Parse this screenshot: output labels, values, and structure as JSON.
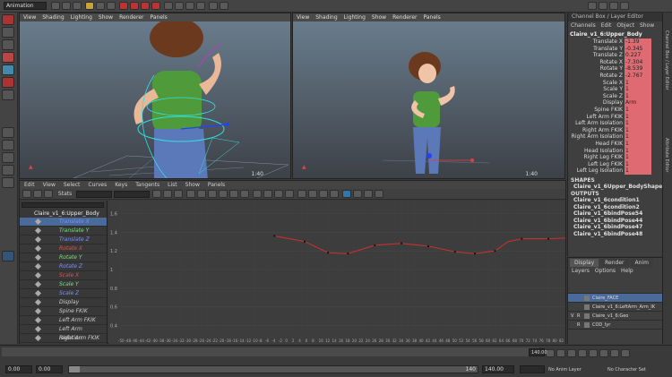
{
  "top_toolbar": {
    "mode": "Animation"
  },
  "viewport_left": {
    "menu": [
      "View",
      "Shading",
      "Lighting",
      "Show",
      "Renderer",
      "Panels"
    ],
    "fps": "1:40"
  },
  "viewport_right": {
    "menu": [
      "View",
      "Shading",
      "Lighting",
      "Show",
      "Renderer",
      "Panels"
    ],
    "fps": "1:40"
  },
  "channel_box": {
    "title": "Channel Box / Layer Editor",
    "menu": [
      "Channels",
      "Edit",
      "Object",
      "Show"
    ],
    "object": "Claire_v1_6:Upper_Body",
    "attributes": [
      {
        "label": "Translate X",
        "value": "-1.39"
      },
      {
        "label": "Translate Y",
        "value": "-0.345"
      },
      {
        "label": "Translate Z",
        "value": "0.227"
      },
      {
        "label": "Rotate X",
        "value": "-7.304"
      },
      {
        "label": "Rotate Y",
        "value": "-8.539"
      },
      {
        "label": "Rotate Z",
        "value": "-2.767"
      },
      {
        "label": "Scale X",
        "value": "1"
      },
      {
        "label": "Scale Y",
        "value": "1"
      },
      {
        "label": "Scale Z",
        "value": "1"
      },
      {
        "label": "Display",
        "value": "Arm"
      },
      {
        "label": "Spine FKIK",
        "value": "1"
      },
      {
        "label": "Left Arm FKIK",
        "value": "1"
      },
      {
        "label": "Left Arm Isolation",
        "value": "1"
      },
      {
        "label": "Right Arm FKIK",
        "value": "1"
      },
      {
        "label": "Right Arm Isolation",
        "value": "1"
      },
      {
        "label": "Head FKIK",
        "value": "1"
      },
      {
        "label": "Head Isolation",
        "value": "1"
      },
      {
        "label": "Right Leg FKIK",
        "value": "1"
      },
      {
        "label": "Left Leg FKIK",
        "value": "1"
      },
      {
        "label": "Left Leg Isolation",
        "value": "1"
      }
    ],
    "shapes_header": "SHAPES",
    "shapes": [
      "Claire_v1_6Upper_BodyShape"
    ],
    "outputs_header": "OUTPUTS",
    "outputs": [
      "Claire_v1_6condition1",
      "Claire_v1_6condition2",
      "Claire_v1_6bindPose54",
      "Claire_v1_6bindPose44",
      "Claire_v1_6bindPose47",
      "Claire_v1_6bindPose48"
    ]
  },
  "layer_editor": {
    "tabs": [
      "Display",
      "Render",
      "Anim"
    ],
    "menu": [
      "Layers",
      "Options",
      "Help"
    ],
    "layers": [
      {
        "v": "",
        "r": "",
        "name": "Claire_FACE"
      },
      {
        "v": "",
        "r": "",
        "name": "Claire_v1_6:LeftArm_Arm_IK"
      },
      {
        "v": "V",
        "r": "R",
        "name": "Claire_v1_6:Geo"
      },
      {
        "v": "",
        "r": "R",
        "name": "COD_Iyr"
      }
    ]
  },
  "graph_editor": {
    "menu": [
      "Edit",
      "View",
      "Select",
      "Curves",
      "Keys",
      "Tangents",
      "List",
      "Show",
      "Panels"
    ],
    "stats_label": "Stats",
    "outliner_root": "Claire_v1_6:Upper_Body",
    "channels": [
      {
        "name": "Translate X",
        "color": "#7f8fff"
      },
      {
        "name": "Translate Y",
        "color": "#7ce07c"
      },
      {
        "name": "Translate Z",
        "color": "#7f8fff"
      },
      {
        "name": "Rotate X",
        "color": "#e05050"
      },
      {
        "name": "Rotate Y",
        "color": "#7ce07c"
      },
      {
        "name": "Rotate Z",
        "color": "#7f8fff"
      },
      {
        "name": "Scale X",
        "color": "#e05050"
      },
      {
        "name": "Scale Y",
        "color": "#7ce07c"
      },
      {
        "name": "Scale Z",
        "color": "#7f8fff"
      },
      {
        "name": "Display",
        "color": "#cccccc"
      },
      {
        "name": "Spine FKIK",
        "color": "#cccccc"
      },
      {
        "name": "Left Arm FKIK",
        "color": "#cccccc"
      },
      {
        "name": "Left Arm Isolation",
        "color": "#cccccc"
      },
      {
        "name": "Right Arm FKIK",
        "color": "#cccccc"
      }
    ],
    "y_ticks": [
      "1.6",
      "1.4",
      "1.2",
      "1",
      "0.8",
      "0.6",
      "0.4"
    ],
    "x_start": -50,
    "x_step": 2,
    "x_count": 67,
    "curve": [
      [
        -4,
        1.36
      ],
      [
        5,
        1.3
      ],
      [
        12,
        1.18
      ],
      [
        18,
        1.17
      ],
      [
        26,
        1.26
      ],
      [
        34,
        1.28
      ],
      [
        42,
        1.25
      ],
      [
        50,
        1.19
      ],
      [
        56,
        1.17
      ],
      [
        62,
        1.2
      ],
      [
        66,
        1.3
      ],
      [
        70,
        1.33
      ],
      [
        78,
        1.33
      ],
      [
        84,
        1.34
      ],
      [
        92,
        1.34
      ]
    ],
    "keys": [
      [
        -4,
        1.36
      ],
      [
        5,
        1.3
      ],
      [
        12,
        1.18
      ],
      [
        18,
        1.17
      ],
      [
        26,
        1.26
      ],
      [
        34,
        1.28
      ],
      [
        42,
        1.25
      ],
      [
        50,
        1.19
      ],
      [
        56,
        1.17
      ],
      [
        62,
        1.2
      ],
      [
        70,
        1.33
      ],
      [
        78,
        1.33
      ],
      [
        84,
        1.34
      ]
    ]
  },
  "time_slider": {
    "start": "0.00",
    "current_left": "0.00",
    "range_end": "140",
    "end": "140.00",
    "current_frame": "140.00",
    "anim_layer": "No Anim Layer",
    "char_set": "No Character Set"
  },
  "side_tabs": [
    "Channel Box / Layer Editor",
    "Attribute Editor"
  ]
}
